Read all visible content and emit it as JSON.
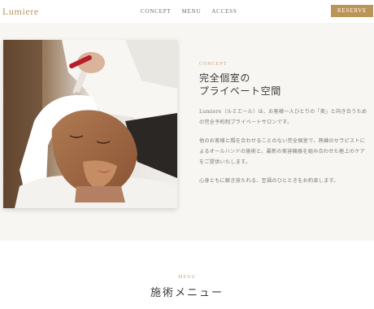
{
  "header": {
    "logo": "Lumiere",
    "nav": [
      "CONCEPT",
      "MENU",
      "ACCESS"
    ],
    "reserve_label": "RESERVE",
    "accent_color": "#bb9457"
  },
  "concept": {
    "label": "CONCEPT",
    "title_line1": "完全個室の",
    "title_line2": "プライベート空間",
    "paragraphs": [
      [
        "Lumiere（ルミエール）は、お客様一人ひとりの「美」と向き合うため",
        "の完全予約制プライベートサロンです。"
      ],
      [
        "他のお客様と顔を合わせることのない完全個室で、熟練のセラピストに",
        "よるオールハンドの施術と、最新の美容機器を組み合わせた極上のケア",
        "をご提供いたします。"
      ],
      [
        "心身ともに解き放たれる、至福のひとときをお約束します。"
      ]
    ]
  },
  "menu_section": {
    "label": "MENU",
    "title": "施術メニュー"
  }
}
